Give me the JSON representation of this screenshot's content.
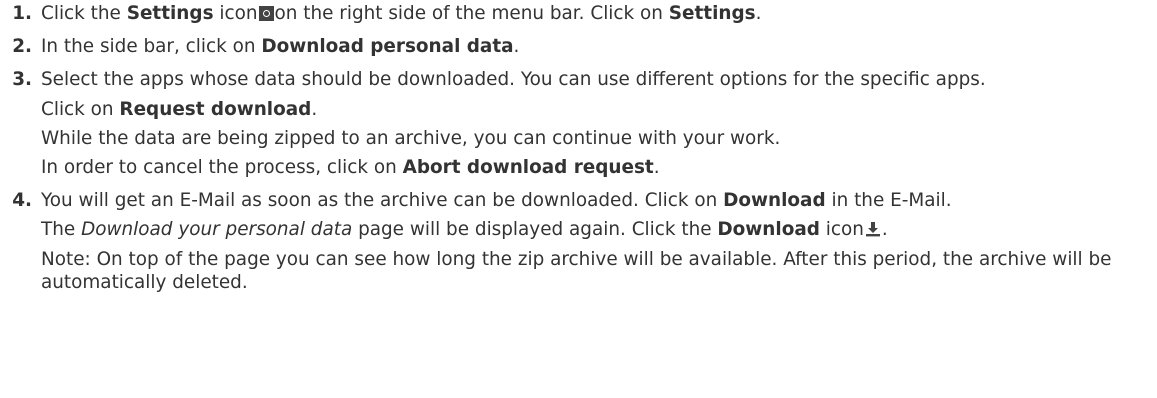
{
  "steps": [
    {
      "number": "1.",
      "p1": {
        "a": "Click the ",
        "b": "Settings",
        "c": " icon",
        "d": "on the right side of the menu bar. Click on ",
        "e": "Settings",
        "f": "."
      }
    },
    {
      "number": "2.",
      "p1": {
        "a": "In the side bar, click on ",
        "b": "Download personal data",
        "c": "."
      }
    },
    {
      "number": "3.",
      "p1": "Select the apps whose data should be downloaded. You can use different options for the specific apps.",
      "p2": {
        "a": "Click on ",
        "b": "Request download",
        "c": "."
      },
      "p3": "While the data are being zipped to an archive, you can continue with your work.",
      "p4": {
        "a": "In order to cancel the process, click on ",
        "b": "Abort download request",
        "c": "."
      }
    },
    {
      "number": "4.",
      "p1": {
        "a": "You will get an E-Mail as soon as the archive can be downloaded. Click on ",
        "b": "Download",
        "c": " in the E-Mail."
      },
      "p2": {
        "a": "The ",
        "b": "Download your personal data",
        "c": " page will be displayed again. Click the ",
        "d": "Download",
        "e": " icon",
        "f": "."
      },
      "p3": "Note: On top of the page you can see how long the zip archive will be available. After this period, the archive will be automatically deleted."
    }
  ],
  "icons": {
    "settings": "gear-icon",
    "download": "download-icon"
  }
}
